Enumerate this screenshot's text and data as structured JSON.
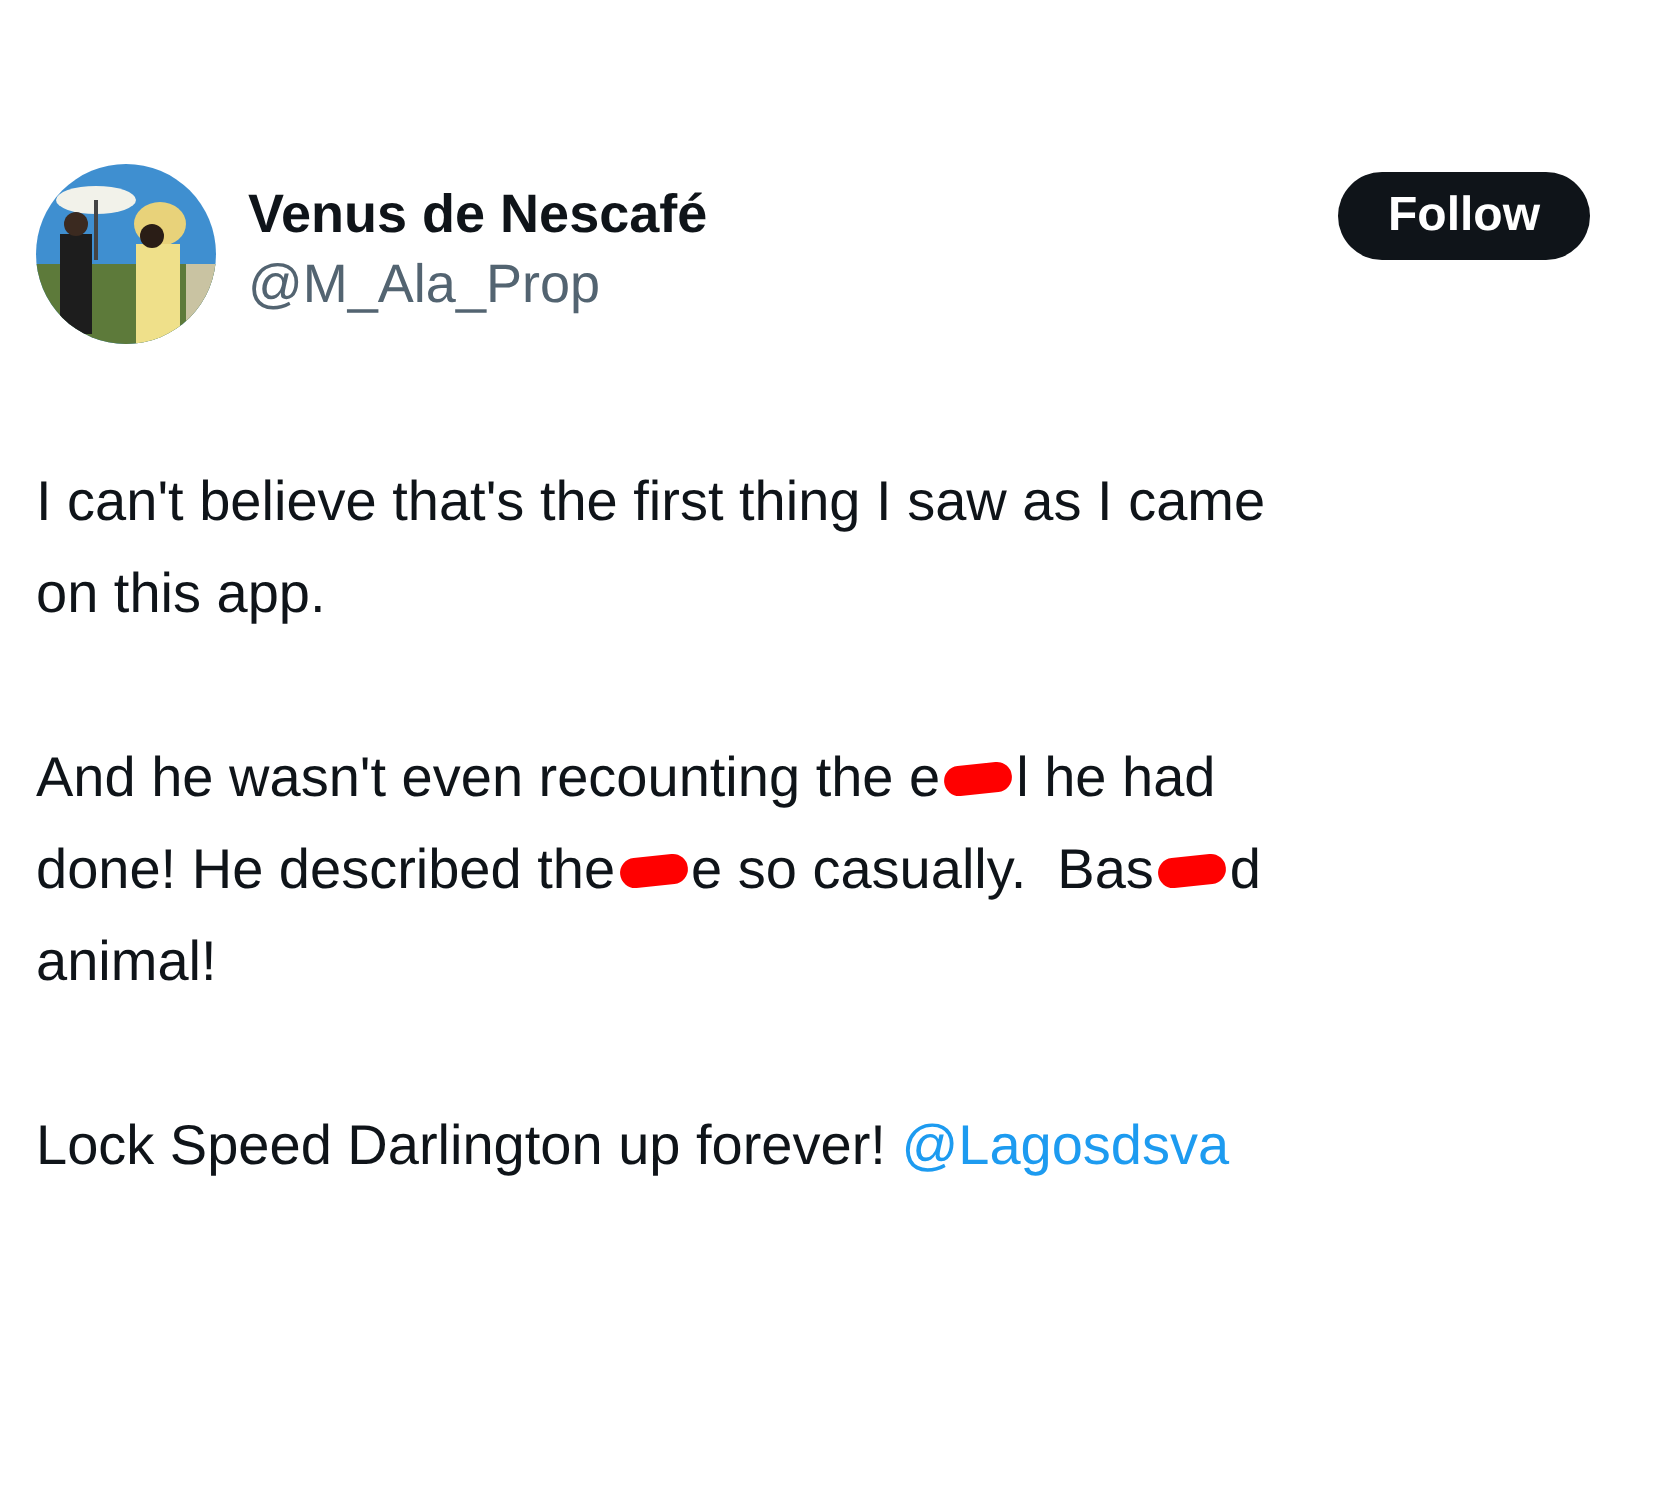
{
  "author": {
    "name": "Venus de Nescafé",
    "handle": "@M_Ala_Prop"
  },
  "follow_button": {
    "label": "Follow"
  },
  "paragraphs": [
    {
      "lines": [
        [
          {
            "kind": "text",
            "text": "I can't believe that's the first thing I saw as I came"
          }
        ],
        [
          {
            "kind": "text",
            "text": "on this app."
          }
        ]
      ]
    },
    {
      "lines": [
        [
          {
            "kind": "text",
            "text": "And he wasn't even recounting the e"
          },
          {
            "kind": "redaction"
          },
          {
            "kind": "text",
            "text": "l he had"
          }
        ],
        [
          {
            "kind": "text",
            "text": "done! He described the"
          },
          {
            "kind": "redaction"
          },
          {
            "kind": "text",
            "text": "e so casually.  Bas"
          },
          {
            "kind": "redaction"
          },
          {
            "kind": "text",
            "text": "d"
          }
        ],
        [
          {
            "kind": "text",
            "text": "animal!"
          }
        ]
      ]
    },
    {
      "lines": [
        [
          {
            "kind": "text",
            "text": "Lock Speed Darlington up forever! "
          },
          {
            "kind": "mention",
            "text": "@Lagosdsva"
          }
        ]
      ]
    }
  ]
}
